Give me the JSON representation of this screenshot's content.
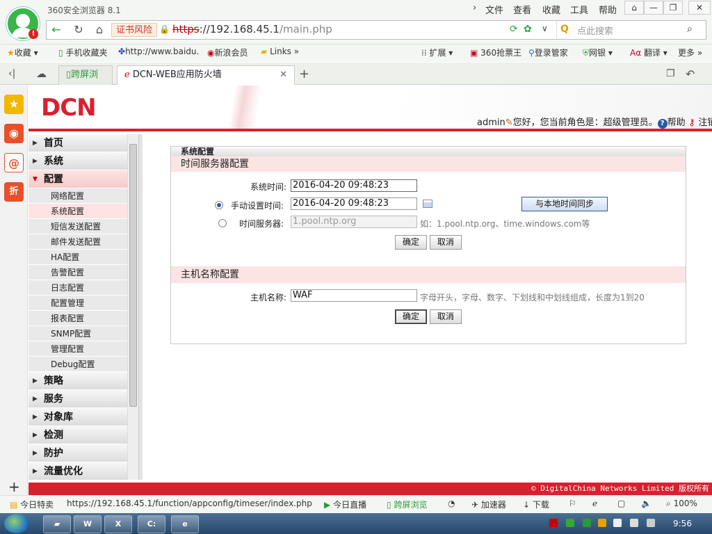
{
  "browser": {
    "app_name": "360安全浏览器 8.1",
    "menu": [
      "文件",
      "查看",
      "收藏",
      "工具",
      "帮助"
    ],
    "cert_warning": "证书风险",
    "url_protocol": "https",
    "url_host": "://192.168.45.1",
    "url_path": "/main.php",
    "search_placeholder": "点此搜索",
    "bookmarks": [
      "收藏",
      "手机收藏夹",
      "http://www.baidu.",
      "新浪会员",
      "Links",
      "扩展",
      "360抢票王",
      "登录管家",
      "网银",
      "翻译",
      "更多"
    ],
    "tabs": [
      "跨屏浏览",
      "DCN-WEB应用防火墙"
    ],
    "status_items": [
      "今日特卖",
      "https://192.168.45.1/function/appconfig/timeser/index.php",
      "今日直播",
      "跨屏浏览",
      "加速器",
      "下载",
      "100%"
    ]
  },
  "app": {
    "logo": "DCN",
    "user": "admin",
    "greeting": "您好，您当前角色是：超级管理员。",
    "help": "帮助",
    "logout": "注销",
    "footer": "© DigitalChina Networks Limited 版权所有"
  },
  "sidebar": {
    "sections_top": [
      "首页",
      "系统",
      "配置"
    ],
    "config_items": [
      "网络配置",
      "系统配置",
      "短信发送配置",
      "邮件发送配置",
      "HA配置",
      "告警配置",
      "日志配置",
      "配置管理",
      "报表配置",
      "SNMP配置",
      "管理配置",
      "Debug配置"
    ],
    "sections_bottom": [
      "策略",
      "服务",
      "对象库",
      "检测",
      "防护",
      "流量优化"
    ]
  },
  "form": {
    "panel_title": "系统配置",
    "time_section": "时间服务器配置",
    "system_time_label": "系统时间:",
    "system_time_value": "2016-04-20 09:48:23",
    "manual_label": "手动设置时间:",
    "manual_value": "2016-04-20 09:48:23",
    "sync_button": "与本地时间同步",
    "ntp_label": "时间服务器:",
    "ntp_value": "1.pool.ntp.org",
    "ntp_hint": "如：1.pool.ntp.org、time.windows.com等",
    "ok": "确定",
    "cancel": "取消",
    "host_section": "主机名称配置",
    "host_label": "主机名称:",
    "host_value": "WAF",
    "host_hint": "字母开头，字母、数字、下划线和中划线组成，长度为1到20"
  },
  "taskbar": {
    "clock": "9:56"
  }
}
